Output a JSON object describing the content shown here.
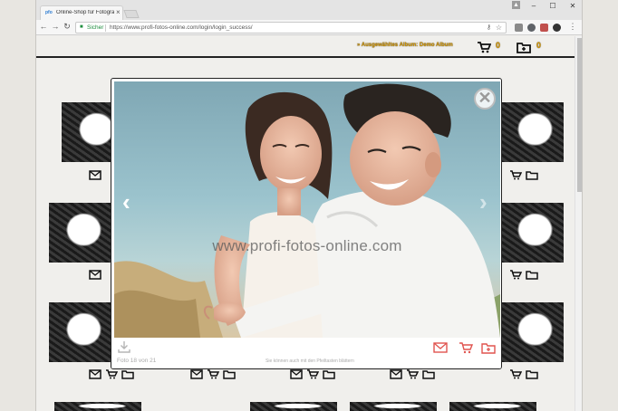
{
  "browser": {
    "tab_title": "Online-Shop für Fotogra",
    "tab_favicon": "pfo",
    "secure_label": "Sicher",
    "url": "https://www.profi-fotos-online.com/login/login_success/",
    "window_controls": {
      "minimize": "–",
      "maximize": "☐",
      "close": "✕"
    }
  },
  "header": {
    "album_link": "» Ausgewähltes Album: Demo Album",
    "cart_count": "0",
    "folder_count": "0"
  },
  "lightbox": {
    "watermark": "www.profi-fotos-online.com",
    "counter": "Foto 18 von 21",
    "hint": "Sie können auch mit den Pfeiltasten blättern",
    "close_symbol": "✕",
    "prev_symbol": "‹",
    "next_symbol": "›"
  },
  "colors": {
    "accent": "#d89a00",
    "icon_red": "#e0544f",
    "secure_green": "#1e8e3e"
  },
  "icons": [
    "download-icon",
    "mail-icon",
    "cart-icon",
    "folder-add-icon",
    "close-icon",
    "chevron-left-icon",
    "chevron-right-icon"
  ]
}
